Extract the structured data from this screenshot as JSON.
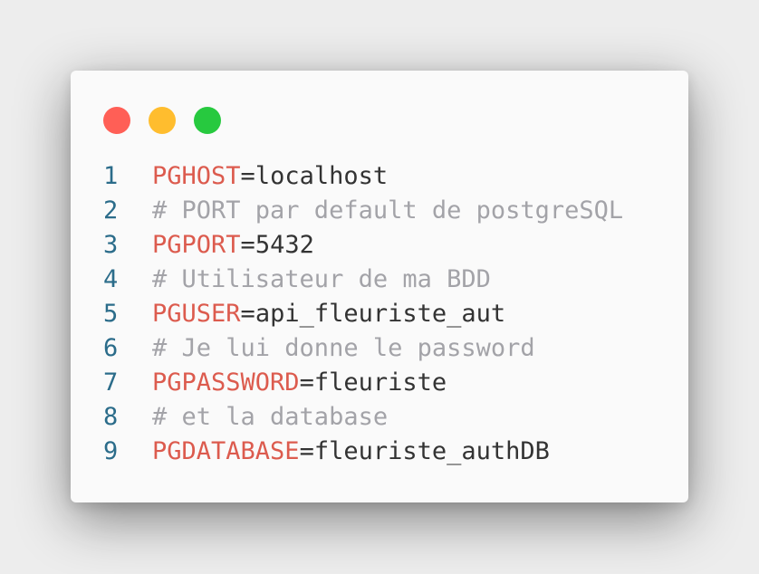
{
  "window": {
    "controls": [
      "close-dot",
      "minimize-dot",
      "maximize-dot"
    ],
    "colors": {
      "close": "#ff5f56",
      "minimize": "#ffbd2e",
      "maximize": "#27c93f"
    }
  },
  "code": {
    "lines": [
      {
        "num": "1",
        "key": "PGHOST",
        "eq": "=",
        "val": "localhost"
      },
      {
        "num": "2",
        "comment": "# PORT par default de postgreSQL"
      },
      {
        "num": "3",
        "key": "PGPORT",
        "eq": "=",
        "val": "5432"
      },
      {
        "num": "4",
        "comment": "# Utilisateur de ma BDD"
      },
      {
        "num": "5",
        "key": "PGUSER",
        "eq": "=",
        "val": "api_fleuriste_aut"
      },
      {
        "num": "6",
        "comment": "# Je lui donne le password"
      },
      {
        "num": "7",
        "key": "PGPASSWORD",
        "eq": "=",
        "val": "fleuriste"
      },
      {
        "num": "8",
        "comment": "# et la database"
      },
      {
        "num": "9",
        "key": "PGDATABASE",
        "eq": "=",
        "val": "fleuriste_authDB"
      }
    ]
  }
}
